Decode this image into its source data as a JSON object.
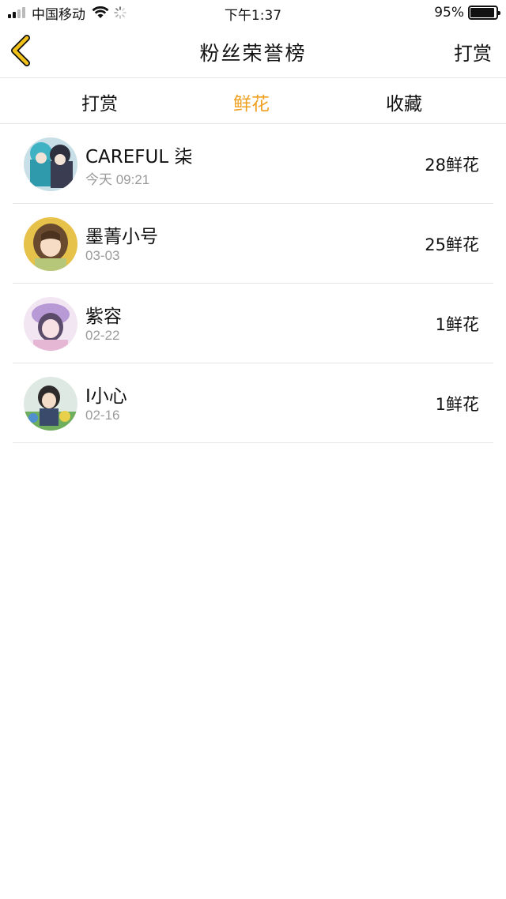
{
  "status_bar": {
    "carrier": "中国移动",
    "time": "下午1:37",
    "battery": "95%",
    "battery_level": 0.95,
    "icons": [
      "signal-icon",
      "wifi-icon",
      "activity-spinner-icon",
      "battery-icon"
    ]
  },
  "header": {
    "back_icon": "chevron-left-icon",
    "title": "粉丝荣誉榜",
    "action_label": "打赏"
  },
  "tabs": [
    {
      "label": "打赏",
      "active": false
    },
    {
      "label": "鲜花",
      "active": true
    },
    {
      "label": "收藏",
      "active": false
    }
  ],
  "colors": {
    "accent": "#f0a020",
    "back_icon": "#f2c21b",
    "secondary_text": "#9a9a9a",
    "divider": "#e6e6e6"
  },
  "fans": [
    {
      "name": "CAREFUL 柒",
      "date": "今天 09:21",
      "amount": "28鲜花"
    },
    {
      "name": "墨菁小号",
      "date": "03-03",
      "amount": "25鲜花"
    },
    {
      "name": "紫容",
      "date": "02-22",
      "amount": "1鲜花"
    },
    {
      "name": "I小心",
      "date": "02-16",
      "amount": "1鲜花"
    }
  ]
}
